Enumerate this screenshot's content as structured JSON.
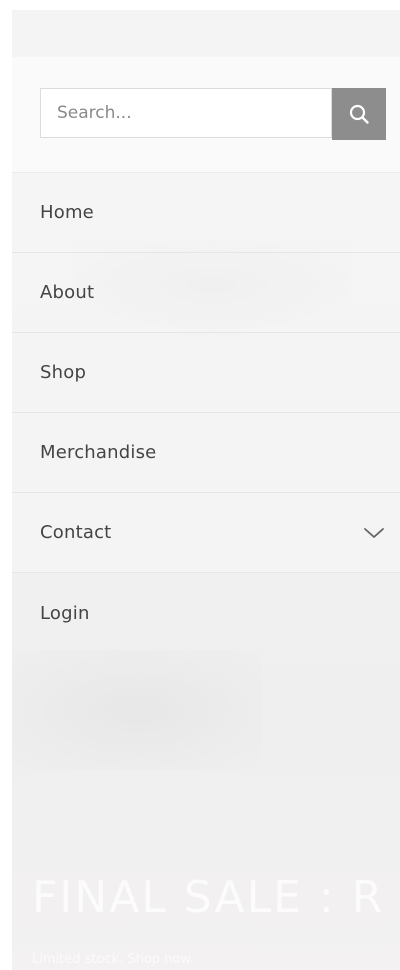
{
  "hero": {
    "sale_text": "FINAL SALE : R",
    "sub_text": "Limited stock. Shop now."
  },
  "search": {
    "placeholder": "Search...",
    "icon": "search-icon",
    "button_color": "#8d8d8d"
  },
  "menu": {
    "items": [
      {
        "label": "Home"
      },
      {
        "label": "About"
      },
      {
        "label": "Shop"
      },
      {
        "label": "Merchandise"
      },
      {
        "label": "Contact",
        "icon": "chevron-down-icon"
      },
      {
        "label": "Login"
      }
    ]
  }
}
